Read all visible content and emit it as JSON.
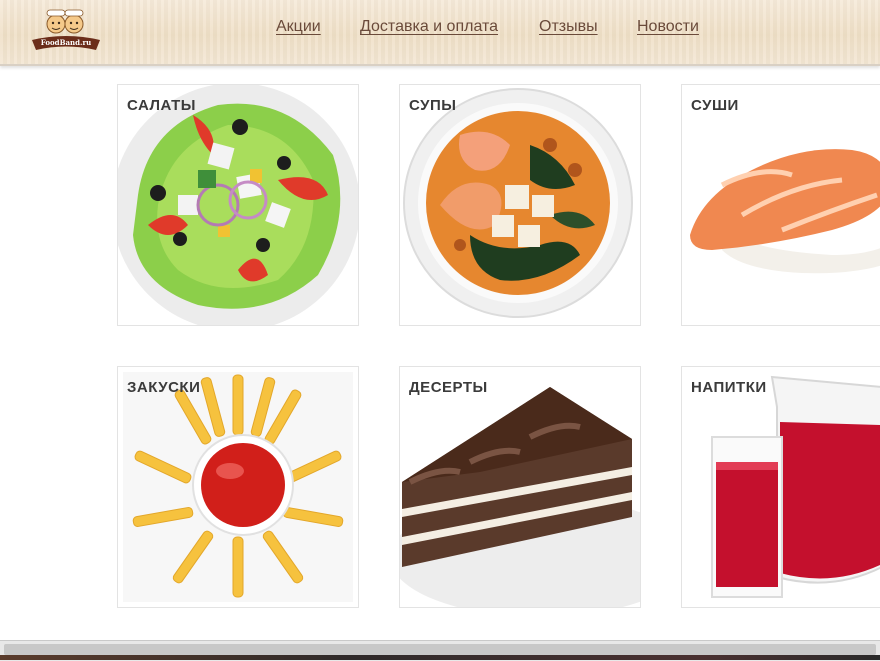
{
  "header": {
    "logo_text": "FoodBand.ru",
    "nav": [
      {
        "label": "Акции"
      },
      {
        "label": "Доставка и оплата"
      },
      {
        "label": "Отзывы"
      },
      {
        "label": "Новости"
      }
    ]
  },
  "categories": [
    {
      "label": "САЛАТЫ",
      "icon": "salad-image"
    },
    {
      "label": "СУПЫ",
      "icon": "soup-image"
    },
    {
      "label": "СУШИ",
      "icon": "sushi-image"
    },
    {
      "label": "ЗАКУСКИ",
      "icon": "fries-image"
    },
    {
      "label": "ДЕСЕРТЫ",
      "icon": "cake-image"
    },
    {
      "label": "НАПИТКИ",
      "icon": "drinks-image"
    }
  ],
  "colors": {
    "header_bg": "#efdfc6",
    "nav_link": "#6a4a3a",
    "card_label": "#3b3b3b",
    "card_border": "#e3e3e3"
  }
}
